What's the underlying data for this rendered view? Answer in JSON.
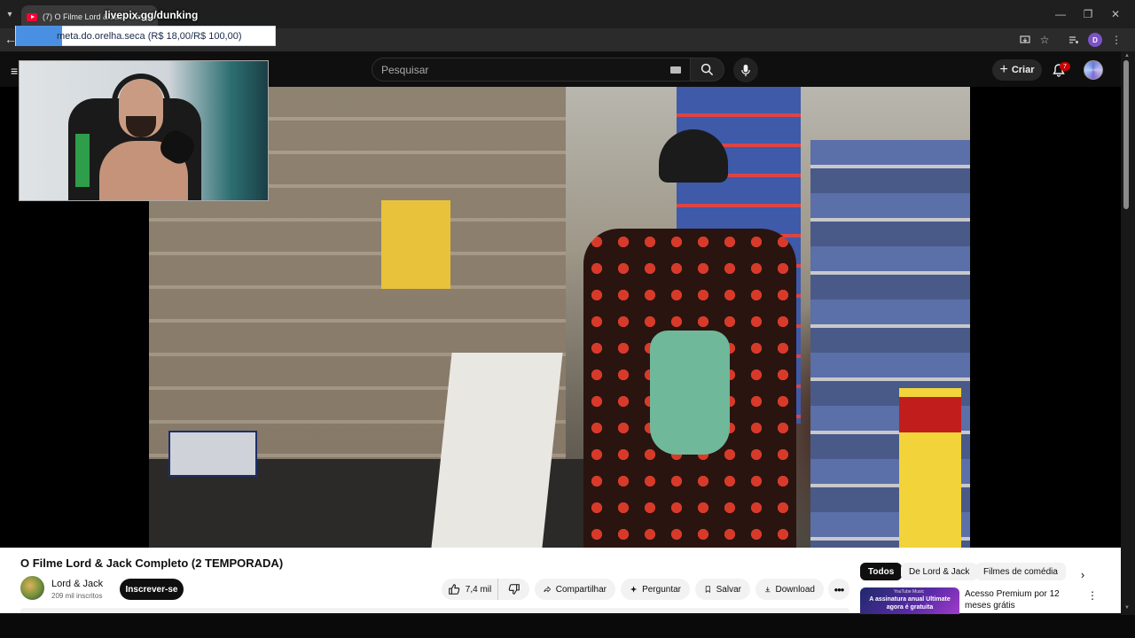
{
  "browser": {
    "tab_title": "(7) O Filme Lord & Jack Completo (2 TEMPORADA) - YouTube",
    "window_controls": [
      "—",
      "❐",
      "✕"
    ],
    "profile_initial": "D"
  },
  "overlay": {
    "stream_handle": "livepix.gg/dunking",
    "goal_text": "meta.do.orelha.seca (R$ 18,00/R$ 100,00)"
  },
  "youtube": {
    "search_placeholder": "Pesquisar",
    "create_label": "Criar",
    "notification_count": "7",
    "video": {
      "title": "O Filme Lord & Jack Completo (2 TEMPORADA)",
      "channel_name": "Lord & Jack",
      "subscribers": "209 mil inscritos",
      "subscribe_label": "Inscrever-se",
      "likes": "7,4 mil",
      "share_label": "Compartilhar",
      "ask_label": "Perguntar",
      "save_label": "Salvar",
      "download_label": "Download",
      "more_label": "•••"
    },
    "chips": [
      "Todos",
      "De Lord & Jack",
      "Filmes de comédia"
    ],
    "ad": {
      "brand": "YouTube Music",
      "thumb_text": "A assinatura anual Ultimate agora é gratuita",
      "title": "Acesso Premium por 12 meses grátis"
    }
  },
  "colors": {
    "accent_red": "#ff0033",
    "subscribe_bg": "#0f0f0f",
    "page_bg": "#0f0f0f",
    "goal_accent": "#4a90e2"
  },
  "icons": [
    "chevron-down-icon",
    "youtube-favicon",
    "back-arrow-icon",
    "install-icon",
    "star-icon",
    "media-icon",
    "menu-icon",
    "hamburger-icon",
    "keyboard-icon",
    "search-icon",
    "mic-icon",
    "plus-icon",
    "bell-icon",
    "like-icon",
    "dislike-icon",
    "share-icon",
    "sparkle-icon",
    "bookmark-icon",
    "download-icon",
    "chevron-right-icon",
    "kebab-icon"
  ]
}
